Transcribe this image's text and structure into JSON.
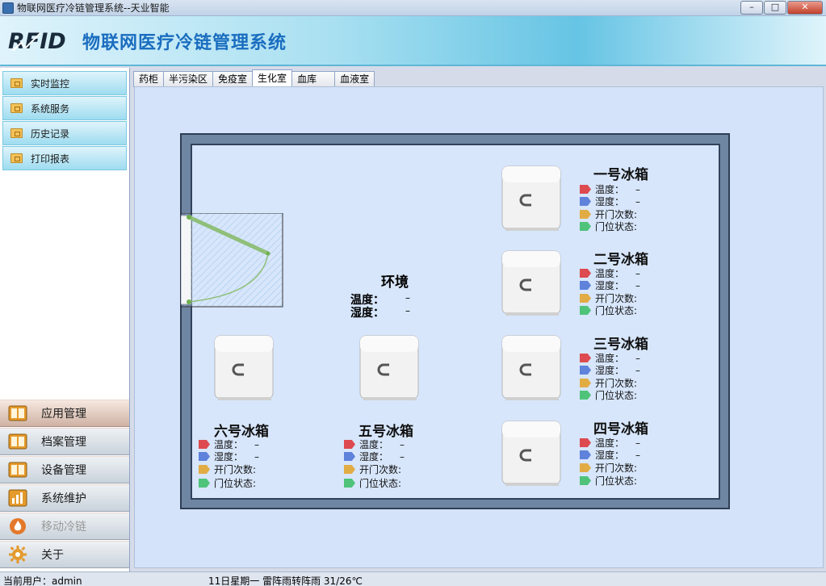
{
  "window": {
    "title": "物联网医疗冷链管理系统--天业智能",
    "minimize_label": "–",
    "maximize_label": "□",
    "close_label": "✕"
  },
  "header": {
    "logo_text": "RFID",
    "system_title": "物联网医疗冷链管理系统"
  },
  "sidebar": {
    "nav_items": [
      {
        "label": "实时监控"
      },
      {
        "label": "系统服务"
      },
      {
        "label": "历史记录"
      },
      {
        "label": "打印报表"
      }
    ],
    "menu_items": [
      {
        "label": "应用管理",
        "icon": "panel-icon"
      },
      {
        "label": "档案管理",
        "icon": "panel-icon"
      },
      {
        "label": "设备管理",
        "icon": "panel-icon"
      },
      {
        "label": "系统维护",
        "icon": "bar-chart-icon"
      },
      {
        "label": "移动冷链",
        "icon": "fire-icon"
      },
      {
        "label": "关于",
        "icon": "gear-icon"
      }
    ]
  },
  "tabs": [
    {
      "label": "药柜"
    },
    {
      "label": "半污染区"
    },
    {
      "label": "免疫室"
    },
    {
      "label": "生化室",
      "active": true
    },
    {
      "label": "血库"
    },
    {
      "label": "血液室"
    }
  ],
  "environment": {
    "title": "环境",
    "temp_label": "温度：",
    "temp_value": "–",
    "humidity_label": "湿度：",
    "humidity_value": "–"
  },
  "labels": {
    "temp": "温度：",
    "humidity": "湿度：",
    "door_count": "开门次数:",
    "door_status": "门位状态:"
  },
  "fridges": [
    {
      "name": "一号冰箱",
      "temp": "–",
      "humidity": "–"
    },
    {
      "name": "二号冰箱",
      "temp": "–",
      "humidity": "–"
    },
    {
      "name": "三号冰箱",
      "temp": "–",
      "humidity": "–"
    },
    {
      "name": "四号冰箱",
      "temp": "–",
      "humidity": "–"
    },
    {
      "name": "五号冰箱",
      "temp": "–",
      "humidity": "–"
    },
    {
      "name": "六号冰箱",
      "temp": "–",
      "humidity": "–"
    }
  ],
  "colors": {
    "temp": "#dd4b51",
    "humidity": "#5f82db",
    "door_count": "#e2ac45",
    "door_status": "#4fc37a"
  },
  "status": {
    "user": "当前用户：admin",
    "weather": "11日星期一  雷阵雨转阵雨  31/26℃"
  }
}
